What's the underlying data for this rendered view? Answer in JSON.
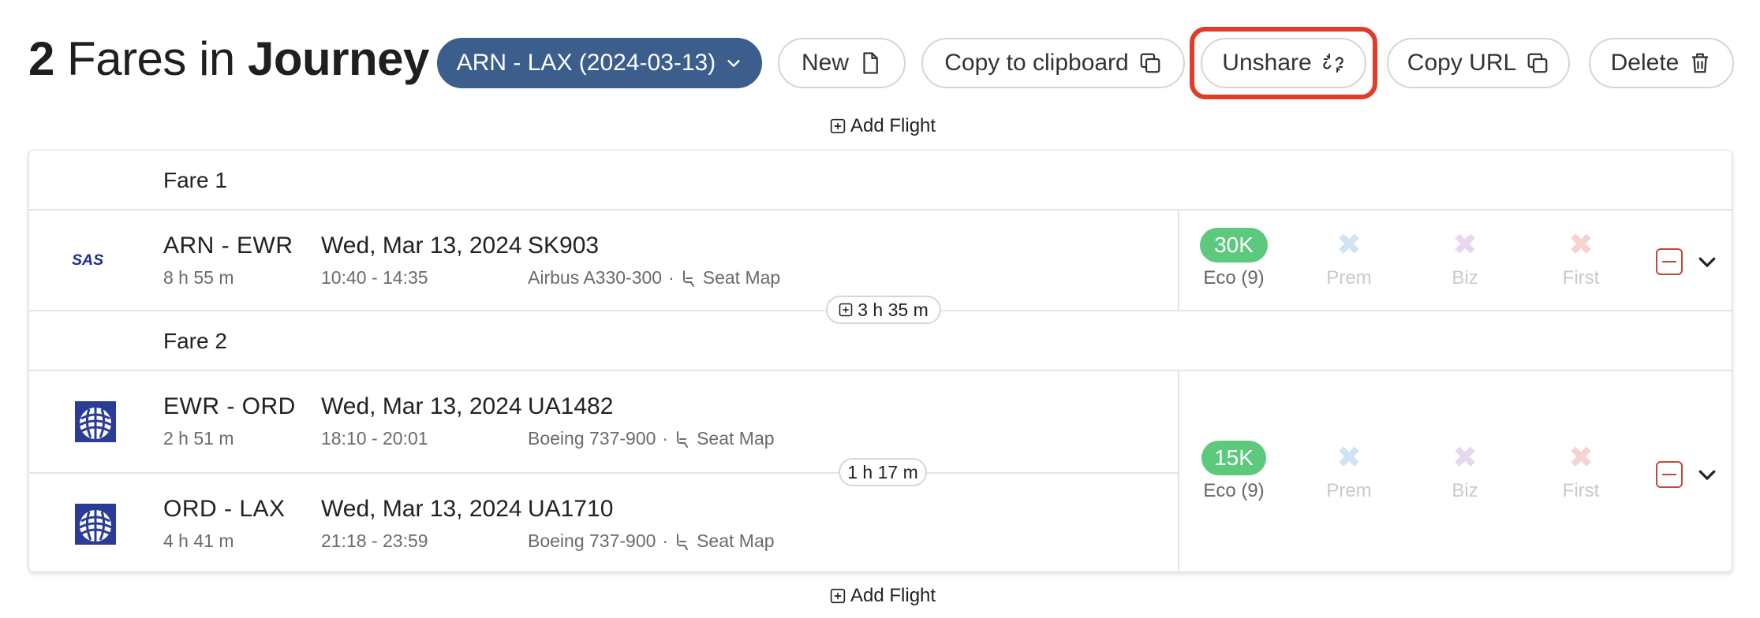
{
  "header": {
    "count": "2",
    "title_mid": " Fares in ",
    "title_end": "Journey"
  },
  "toolbar": {
    "journey_select": "ARN - LAX (2024-03-13)",
    "new_label": "New",
    "copy_clipboard_label": "Copy to clipboard",
    "unshare_label": "Unshare",
    "copy_url_label": "Copy URL",
    "delete_label": "Delete"
  },
  "add_flight_label": "Add Flight",
  "fares": [
    {
      "label": "Fare 1",
      "flights": [
        {
          "airline_logo": "SAS",
          "route": "ARN - EWR",
          "duration": "8 h 55 m",
          "date": "Wed, Mar 13, 2024",
          "times": "10:40 - 14:35",
          "flight_no": "SK903",
          "aircraft": "Airbus A330-300",
          "seat_map": "Seat Map"
        }
      ],
      "price": "30K",
      "classes": [
        "Eco (9)",
        "Prem",
        "Biz",
        "First"
      ]
    },
    {
      "label": "Fare 2",
      "flights": [
        {
          "airline_logo": "united-globe-logo",
          "route": "EWR - ORD",
          "duration": "2 h 51 m",
          "date": "Wed, Mar 13, 2024",
          "times": "18:10 - 20:01",
          "flight_no": "UA1482",
          "aircraft": "Boeing 737-900",
          "seat_map": "Seat Map"
        },
        {
          "airline_logo": "united-globe-logo",
          "route": "ORD - LAX",
          "duration": "4 h 41 m",
          "date": "Wed, Mar 13, 2024",
          "times": "21:18 - 23:59",
          "flight_no": "UA1710",
          "aircraft": "Boeing 737-900",
          "seat_map": "Seat Map"
        }
      ],
      "price": "15K",
      "classes": [
        "Eco (9)",
        "Prem",
        "Biz",
        "First"
      ]
    }
  ],
  "layovers": [
    "3 h 35 m",
    "1 h 17 m"
  ],
  "colors": {
    "primary": "#3b5e8c",
    "highlight": "#e23b2a",
    "price_green": "#5dc97d",
    "prem_x": "#cfe3f3",
    "biz_x": "#e6d8ee",
    "first_x": "#f6d2d0",
    "remove_red": "#c4473a"
  }
}
